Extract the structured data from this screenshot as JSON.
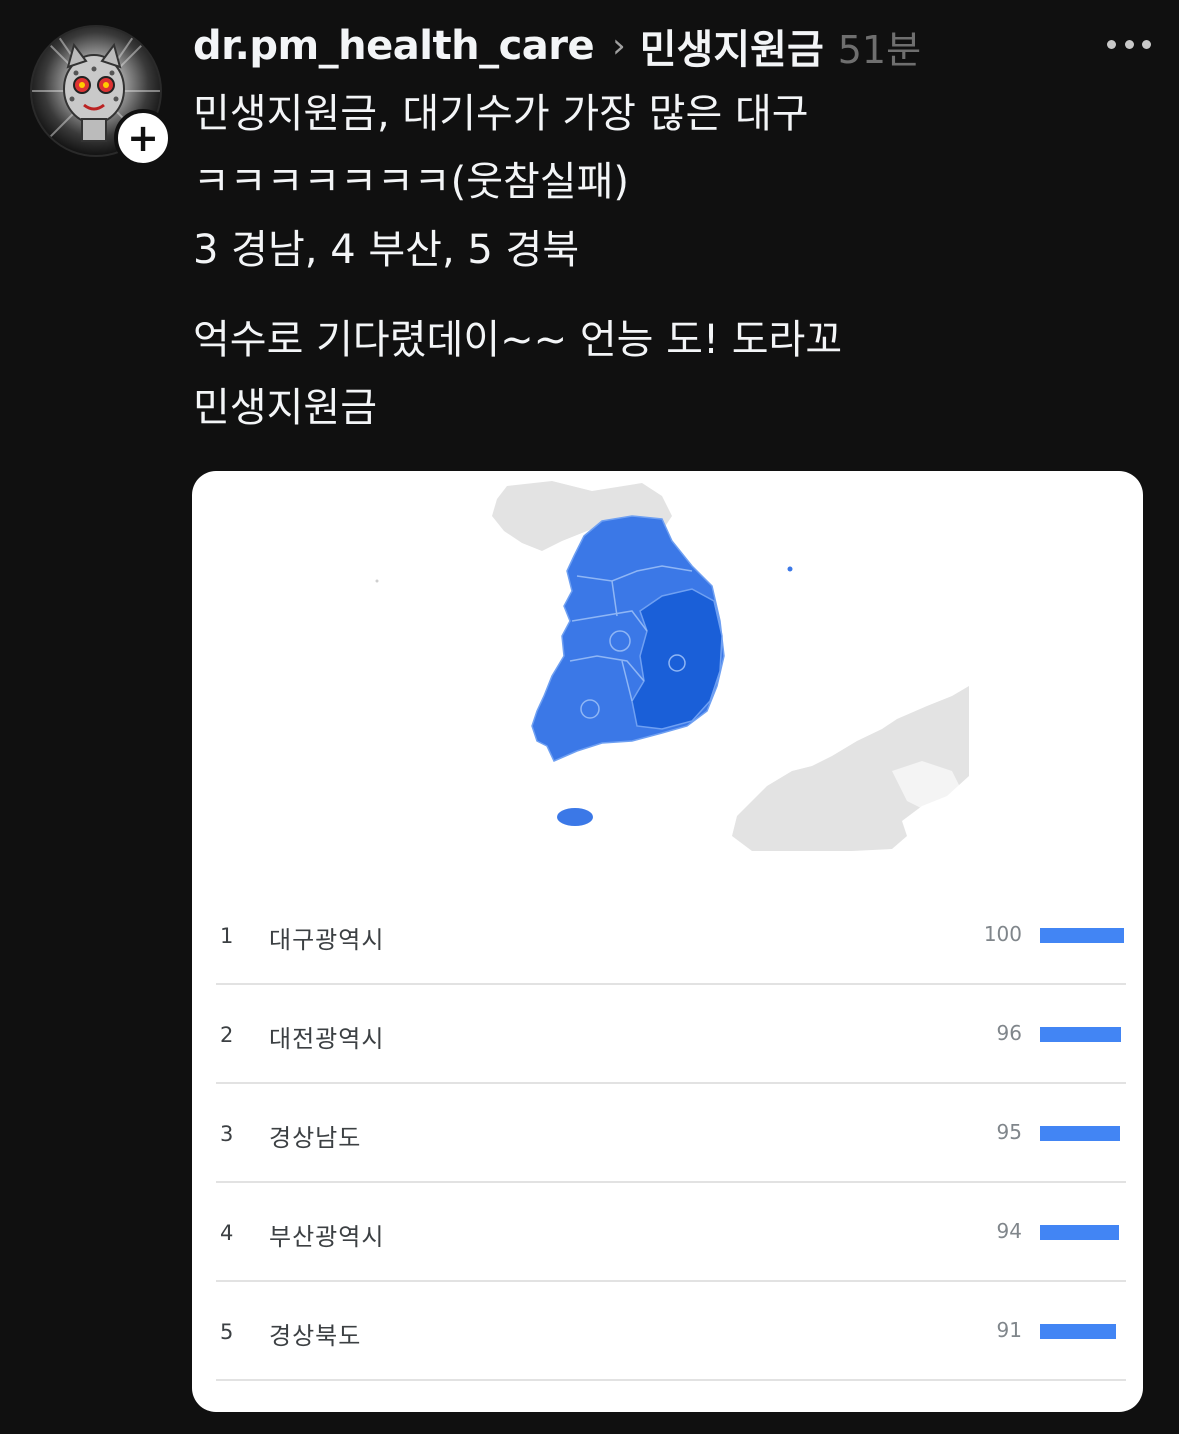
{
  "post": {
    "username": "dr.pm_health_care",
    "topic": "민생지원금",
    "time": "51분",
    "lines": [
      "민생지원금, 대기수가 가장 많은 대구",
      "ㅋㅋㅋㅋㅋㅋㅋ(웃참실패)",
      "3 경남, 4 부산, 5 경북"
    ],
    "lines2": [
      "억수로 기다렸데이~~ 언능 도! 도라꼬",
      "민생지원금"
    ]
  },
  "icons": {
    "avatar": "cat-avatar",
    "follow": "plus-icon",
    "chevron": "chevron-right-icon",
    "more": "more-dots-icon"
  },
  "colors": {
    "background": "#101010",
    "map_fill": "#3b78e7",
    "map_dark": "#1a5fd8",
    "map_other": "#e3e3e3",
    "bar": "#4285f4"
  },
  "rankings": [
    {
      "rank": "1",
      "name": "대구광역시",
      "value": "100",
      "fraction": 1.0
    },
    {
      "rank": "2",
      "name": "대전광역시",
      "value": "96",
      "fraction": 0.96
    },
    {
      "rank": "3",
      "name": "경상남도",
      "value": "95",
      "fraction": 0.95
    },
    {
      "rank": "4",
      "name": "부산광역시",
      "value": "94",
      "fraction": 0.94
    },
    {
      "rank": "5",
      "name": "경상북도",
      "value": "91",
      "fraction": 0.91
    }
  ]
}
